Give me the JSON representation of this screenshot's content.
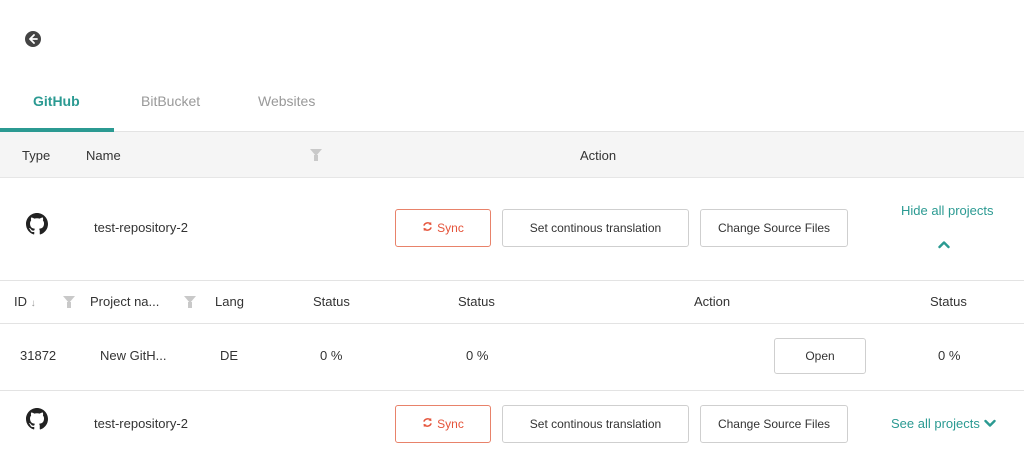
{
  "tabs": [
    {
      "label": "GitHub",
      "active": true
    },
    {
      "label": "BitBucket",
      "active": false
    },
    {
      "label": "Websites",
      "active": false
    }
  ],
  "table_header": {
    "type": "Type",
    "name": "Name",
    "action": "Action"
  },
  "repositories": [
    {
      "name": "test-repository-2",
      "sync_label": "Sync",
      "continuous_label": "Set continous translation",
      "change_source_label": "Change Source Files",
      "toggle_label": "Hide all projects"
    },
    {
      "name": "test-repository-2",
      "sync_label": "Sync",
      "continuous_label": "Set continous translation",
      "change_source_label": "Change Source Files",
      "toggle_label": "See all projects"
    }
  ],
  "projects_header": {
    "id": "ID",
    "sort_indicator": "↓",
    "project_name": "Project na...",
    "lang": "Lang",
    "status1": "Status",
    "status2": "Status",
    "action": "Action",
    "status3": "Status"
  },
  "projects": [
    {
      "id": "31872",
      "name": "New GitH...",
      "lang": "DE",
      "status1": "0 %",
      "status2": "0 %",
      "open_label": "Open",
      "status3": "0 %"
    }
  ],
  "colors": {
    "accent": "#2b9a92",
    "sync": "#e5533a",
    "header_band": "#f5f5f5"
  }
}
